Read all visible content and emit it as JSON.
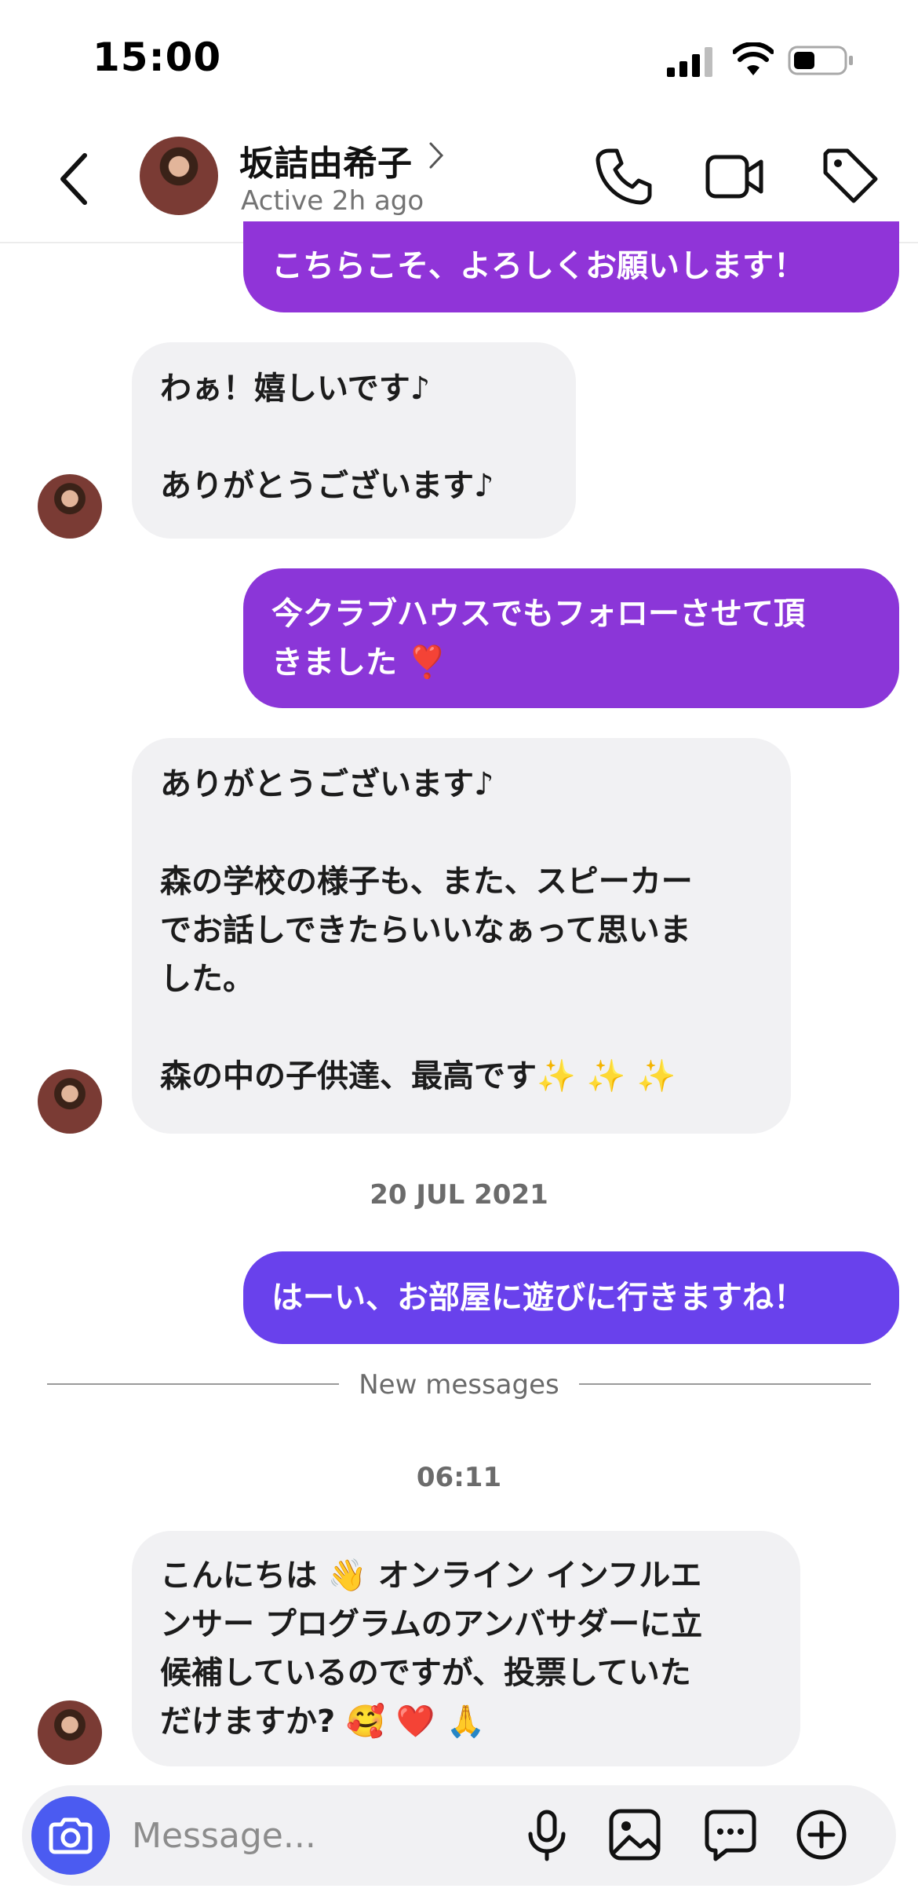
{
  "status_bar": {
    "time": "15:00"
  },
  "header": {
    "name": "坂詰由希子",
    "status": "Active 2h ago",
    "icons": [
      "back-icon",
      "chevron-right-icon",
      "phone-icon",
      "video-icon",
      "tag-icon"
    ]
  },
  "messages": [
    {
      "from": "me",
      "text": "こちらこそ、よろしくお願いします！"
    },
    {
      "from": "them",
      "text": "わぁ！嬉しいです♪\n\nありがとうございます♪"
    },
    {
      "from": "me",
      "text": "今クラブハウスでもフォローさせて頂\nきました ❣️"
    },
    {
      "from": "them",
      "text": "ありがとうございます♪\n\n森の学校の様子も、また、スピーカー\nでお話しできたらいいなぁって思いま\nした。\n\n森の中の子供達、最高です✨ ✨ ✨"
    },
    {
      "from": "me",
      "text": "はーい、お部屋に遊びに行きますね！"
    },
    {
      "from": "them",
      "text": "こんにちは 👋 オンライン インフルエ\nンサー プログラムのアンバサダーに立\n候補しているのですが、投票していた\nだけますか? 🥰 ❤️ 🙏"
    }
  ],
  "separators": {
    "date": "20 JUL 2021",
    "new_messages": "New messages",
    "time": "06:11"
  },
  "composer": {
    "placeholder": "Message...",
    "icons": [
      "camera-icon",
      "microphone-icon",
      "gallery-icon",
      "sticker-chat-icon",
      "plus-icon"
    ]
  },
  "colors": {
    "outgoing_purple": "#9034d8",
    "outgoing_indigo": "#6941ec",
    "incoming_bg": "#f1f1f3",
    "camera_blue": "#4b5bf1"
  }
}
